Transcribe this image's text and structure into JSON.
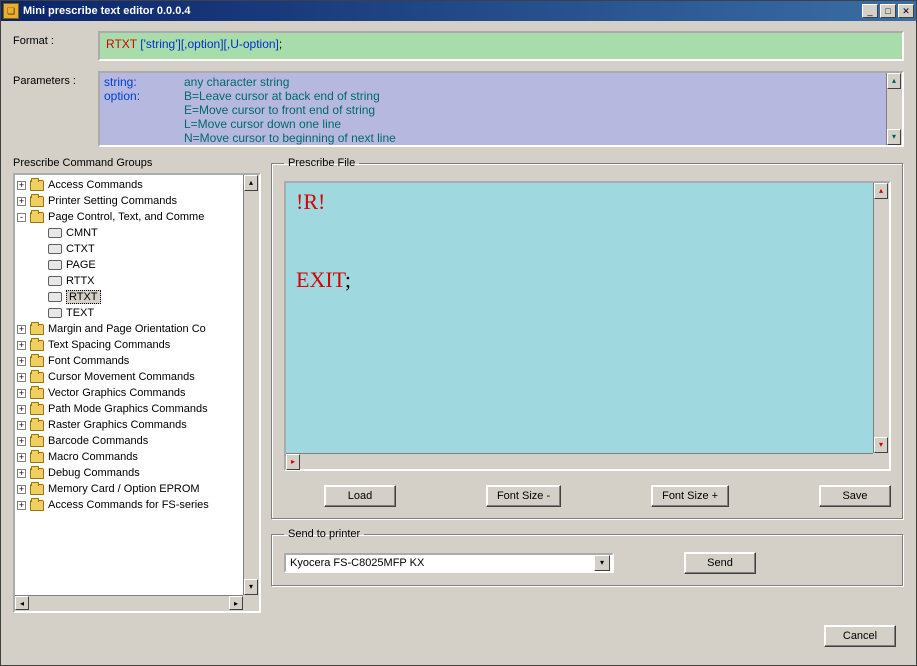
{
  "window_title": "Mini prescribe text editor  0.0.0.4",
  "labels": {
    "format": "Format  :",
    "parameters": "Parameters  :",
    "tree_heading": "Prescribe Command Groups",
    "prescribe_file": "Prescribe File",
    "send_to_printer": "Send to printer"
  },
  "format_syntax": {
    "cmd": "RTXT ",
    "arg": "['string']",
    "opt1": "[,option]",
    "opt2": "[,U-option]",
    "end": ";"
  },
  "parameters_lines": [
    {
      "name": "string:",
      "desc": "any character string"
    },
    {
      "name": "option:",
      "desc": "B=Leave cursor at back end of string"
    },
    {
      "name": "",
      "desc": "E=Move cursor to front end of string"
    },
    {
      "name": "",
      "desc": "L=Move cursor down one line"
    },
    {
      "name": "",
      "desc": "N=Move cursor to beginning of next line"
    }
  ],
  "tree": [
    {
      "depth": 1,
      "exp": "+",
      "type": "folder",
      "label": "Access Commands"
    },
    {
      "depth": 1,
      "exp": "+",
      "type": "folder",
      "label": "Printer Setting Commands"
    },
    {
      "depth": 1,
      "exp": "-",
      "type": "folder",
      "label": "Page Control, Text, and Comme"
    },
    {
      "depth": 2,
      "exp": "",
      "type": "leaf",
      "label": "CMNT"
    },
    {
      "depth": 2,
      "exp": "",
      "type": "leaf",
      "label": "CTXT"
    },
    {
      "depth": 2,
      "exp": "",
      "type": "leaf",
      "label": "PAGE"
    },
    {
      "depth": 2,
      "exp": "",
      "type": "leaf",
      "label": "RTTX"
    },
    {
      "depth": 2,
      "exp": "",
      "type": "leaf",
      "label": "RTXT",
      "selected": true
    },
    {
      "depth": 2,
      "exp": "",
      "type": "leaf",
      "label": "TEXT"
    },
    {
      "depth": 1,
      "exp": "+",
      "type": "folder",
      "label": "Margin and Page Orientation Co"
    },
    {
      "depth": 1,
      "exp": "+",
      "type": "folder",
      "label": "Text Spacing Commands"
    },
    {
      "depth": 1,
      "exp": "+",
      "type": "folder",
      "label": "Font Commands"
    },
    {
      "depth": 1,
      "exp": "+",
      "type": "folder",
      "label": "Cursor Movement Commands"
    },
    {
      "depth": 1,
      "exp": "+",
      "type": "folder",
      "label": "Vector Graphics Commands"
    },
    {
      "depth": 1,
      "exp": "+",
      "type": "folder",
      "label": "Path Mode Graphics Commands"
    },
    {
      "depth": 1,
      "exp": "+",
      "type": "folder",
      "label": "Raster Graphics Commands"
    },
    {
      "depth": 1,
      "exp": "+",
      "type": "folder",
      "label": "Barcode Commands"
    },
    {
      "depth": 1,
      "exp": "+",
      "type": "folder",
      "label": "Macro Commands"
    },
    {
      "depth": 1,
      "exp": "+",
      "type": "folder",
      "label": "Debug Commands"
    },
    {
      "depth": 1,
      "exp": "+",
      "type": "folder",
      "label": "Memory Card / Option EPROM"
    },
    {
      "depth": 1,
      "exp": "+",
      "type": "folder",
      "label": "Access Commands for FS-series"
    }
  ],
  "editor_lines": [
    {
      "text": "!R!",
      "color": "red"
    },
    {
      "text": "",
      "color": "red"
    },
    {
      "text": "",
      "color": "red"
    },
    {
      "text": "EXIT",
      "color": "red",
      "suffix": ";"
    }
  ],
  "buttons": {
    "load": "Load",
    "font_minus": "Font Size -",
    "font_plus": "Font Size +",
    "save": "Save",
    "send": "Send",
    "cancel": "Cancel"
  },
  "printer_selected": "Kyocera FS-C8025MFP KX"
}
